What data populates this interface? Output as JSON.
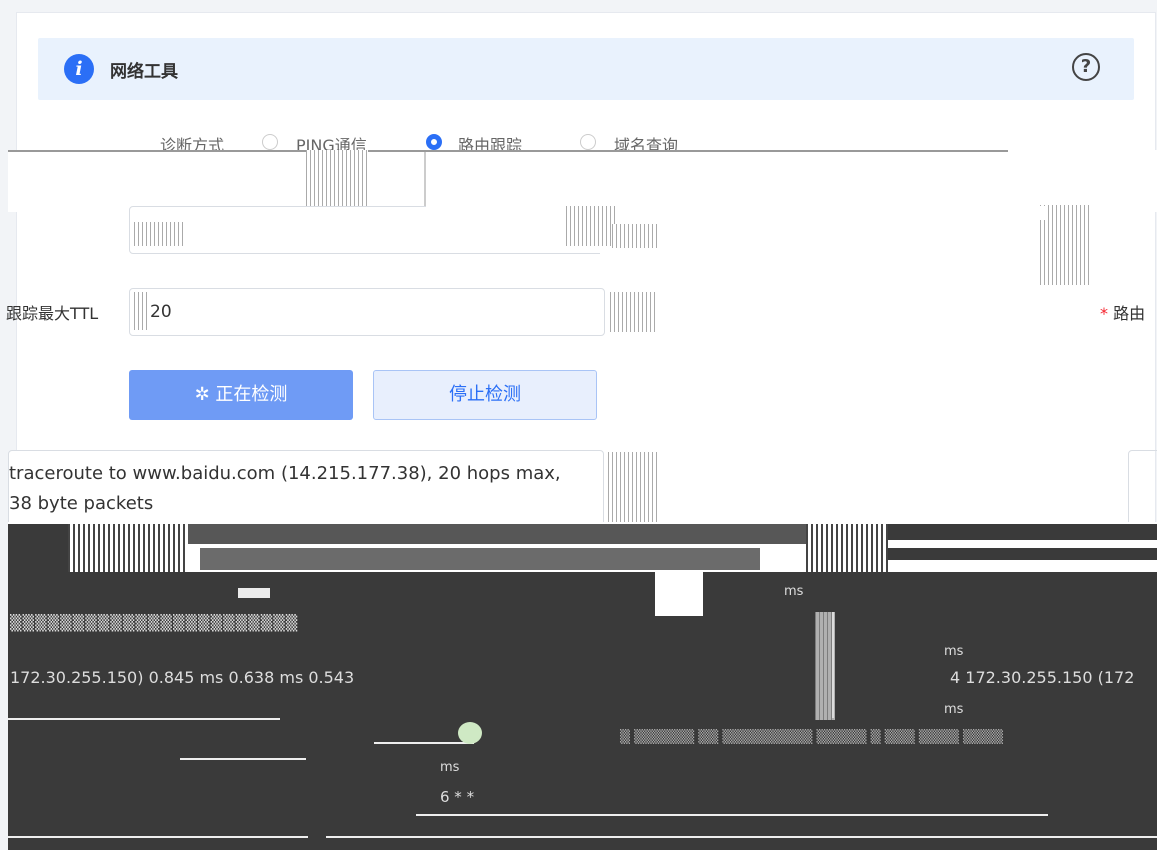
{
  "header": {
    "title": "网络工具",
    "info_icon": "i",
    "help_icon": "?"
  },
  "diagnose": {
    "label": "诊断方式",
    "options": [
      "PING通信",
      "路由跟踪",
      "域名查询"
    ]
  },
  "form": {
    "ttl_label": "跟踪最大TTL",
    "ttl_value": "20",
    "right_required_label": "路由"
  },
  "buttons": {
    "detecting_label": "正在检测",
    "stop_label": "停止检测"
  },
  "result": {
    "line1": "traceroute to www.baidu.com (14.215.177.38), 20 hops max,",
    "line2": "38 byte packets",
    "hop_line": "172.30.255.150)  0.845 ms  0.638 ms  0.543",
    "hop_line_right": "4  172.30.255.150 (172",
    "ms_1": "ms",
    "ms_2": "ms",
    "ms_3": "ms",
    "ms_4": "ms",
    "ms_5": "ms",
    "hop6": "6  *  *"
  },
  "colors": {
    "accent": "#2b6ff6",
    "info_bg": "#e9f2fd",
    "primary_disabled": "#6f9bf5"
  }
}
